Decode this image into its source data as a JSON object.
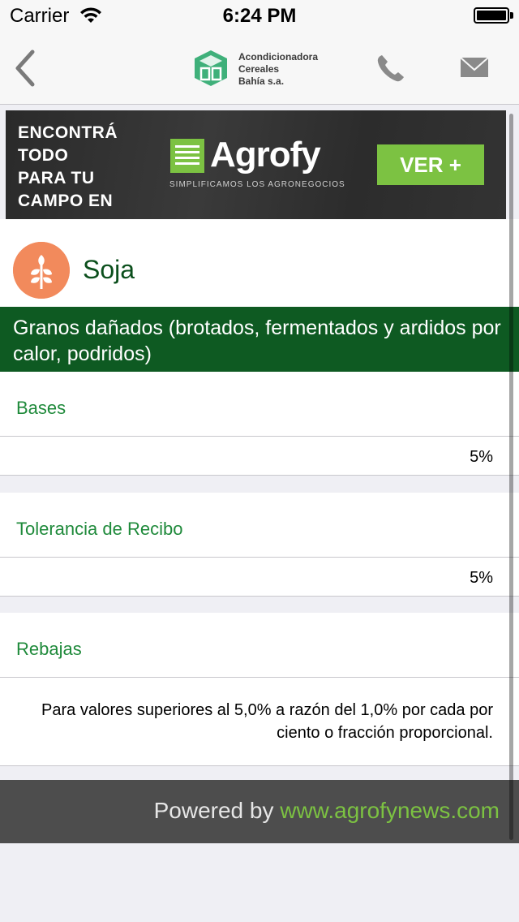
{
  "status_bar": {
    "carrier": "Carrier",
    "time": "6:24 PM"
  },
  "nav": {
    "back_icon": "chevron-left-icon",
    "logo": {
      "line1": "Acondicionadora",
      "line2": "Cereales",
      "line3": "Bahía s.a."
    },
    "phone_icon": "phone-icon",
    "mail_icon": "mail-icon"
  },
  "banner": {
    "left_lines": [
      "ENCONTRÁ",
      "TODO",
      "PARA TU",
      "CAMPO EN"
    ],
    "brand_name": "Agrofy",
    "tagline": "SIMPLIFICAMOS LOS AGRONEGOCIOS",
    "button_label": "VER +",
    "accent_color": "#7cc242"
  },
  "product": {
    "icon": "wheat-icon",
    "title": "Soja",
    "icon_color": "#f28a5c"
  },
  "section": {
    "title": "Granos dañados (brotados, fermentados y ardidos por calor, podridos)",
    "bg_color": "#0e5a22"
  },
  "groups": [
    {
      "label": "Bases",
      "value": "5%"
    },
    {
      "label": "Tolerancia de Recibo",
      "value": "5%"
    },
    {
      "label": "Rebajas",
      "note": "Para valores superiores al 5,0% a razón del 1,0% por cada por ciento o fracción proporcional."
    }
  ],
  "footer": {
    "prefix": "Powered by ",
    "link": "www.agrofynews.com"
  }
}
